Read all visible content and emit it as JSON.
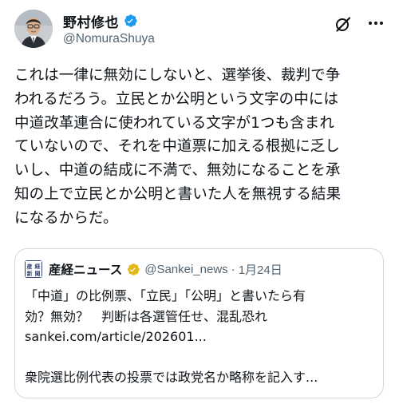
{
  "author": {
    "display_name": "野村修也",
    "handle": "@NomuraShuya",
    "avatar_icon": "person-avatar",
    "verified": true
  },
  "actions": {
    "grok_icon": "grok-icon",
    "more_icon": "more-icon"
  },
  "post": {
    "lines": [
      "これは一律に無効にしないと、選挙後、裁判で争",
      "われるだろう。立民とか公明という文字の中には",
      "中道改革連合に使われている文字が1つも含まれ",
      "ていないので、それを中道票に加える根拠に乏し",
      "いし、中道の結成に不満で、無効になることを承",
      "知の上で立民とか公明と書いた人を無視する結果",
      "になるからだ。"
    ]
  },
  "quote": {
    "logo_icon": "sankei-logo-icon",
    "logo_text": "産経新聞",
    "name": "産経ニュース",
    "handle": "@Sankei_news",
    "separator": "·",
    "date": "1月24日",
    "lines": [
      "「中道」の比例票、「立民」「公明」と書いたら有",
      "効？無効？　判断は各選管任せ、混乱恐れ",
      "sankei.com/article/202601..."
    ],
    "summary": "衆院選比例代表の投票では政党名か略称を記入す..."
  },
  "colors": {
    "text": "#0f1419",
    "secondary": "#536471",
    "verified_blue": "#1d9bf0",
    "verified_gold": "#e2b719",
    "border": "#cfd9de"
  }
}
